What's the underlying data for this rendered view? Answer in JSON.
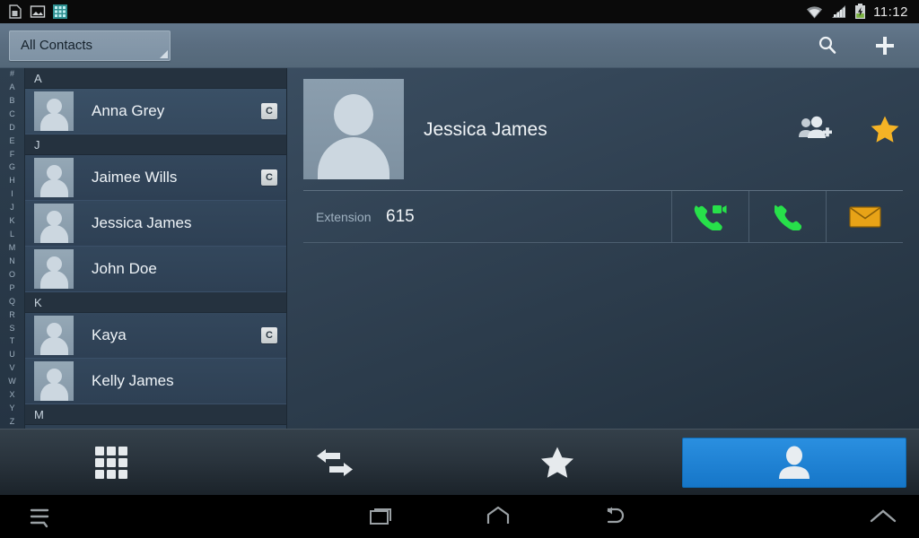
{
  "status_bar": {
    "notifications": [
      "sim-card-icon",
      "image-icon",
      "app-grid-icon"
    ],
    "wifi_icon": "wifi-icon",
    "signal_icon": "cellular-signal-icon",
    "battery_icon": "battery-charging-icon",
    "time": "11:12"
  },
  "action_bar": {
    "spinner_label": "All Contacts",
    "search_icon": "search-icon",
    "add_icon": "add-contact-icon"
  },
  "alpha_index": [
    "#",
    "A",
    "B",
    "C",
    "D",
    "E",
    "F",
    "G",
    "H",
    "I",
    "J",
    "K",
    "L",
    "M",
    "N",
    "O",
    "P",
    "Q",
    "R",
    "S",
    "T",
    "U",
    "V",
    "W",
    "X",
    "Y",
    "Z"
  ],
  "contact_list": [
    {
      "type": "header",
      "label": "A"
    },
    {
      "type": "contact",
      "name": "Anna Grey",
      "badge": "C",
      "selected": true
    },
    {
      "type": "header",
      "label": "J"
    },
    {
      "type": "contact",
      "name": "Jaimee Wills",
      "badge": "C",
      "selected": false
    },
    {
      "type": "contact",
      "name": "Jessica James",
      "badge": "",
      "selected": false
    },
    {
      "type": "contact",
      "name": "John Doe",
      "badge": "",
      "selected": false
    },
    {
      "type": "header",
      "label": "K"
    },
    {
      "type": "contact",
      "name": "Kaya",
      "badge": "C",
      "selected": false
    },
    {
      "type": "contact",
      "name": "Kelly James",
      "badge": "",
      "selected": false
    },
    {
      "type": "header",
      "label": "M"
    }
  ],
  "detail": {
    "name": "Jessica James",
    "avatar": "contact-photo-placeholder",
    "add_to_group_icon": "add-to-group-icon",
    "favorite_icon": "favorite-star-icon",
    "favorite_active": true,
    "rows": [
      {
        "label": "Extension",
        "value": "615",
        "actions": [
          "video-call-icon",
          "voice-call-icon",
          "message-icon"
        ]
      }
    ]
  },
  "tabs": [
    {
      "name": "dialpad",
      "icon": "dialpad-icon",
      "active": false
    },
    {
      "name": "call-log",
      "icon": "call-log-icon",
      "active": false
    },
    {
      "name": "favorites",
      "icon": "star-icon",
      "active": false
    },
    {
      "name": "contacts",
      "icon": "person-icon",
      "active": true
    }
  ],
  "nav_bar": {
    "menu_icon": "menu-icon",
    "recents_icon": "recents-icon",
    "home_icon": "home-icon",
    "back_icon": "back-icon",
    "expand_icon": "chevron-up-icon"
  },
  "colors": {
    "accent_blue": "#1676c8",
    "favorite_gold": "#f5b325",
    "call_green": "#27e04a",
    "message_orange": "#e8a317",
    "action_bar": "#5a6d80"
  }
}
